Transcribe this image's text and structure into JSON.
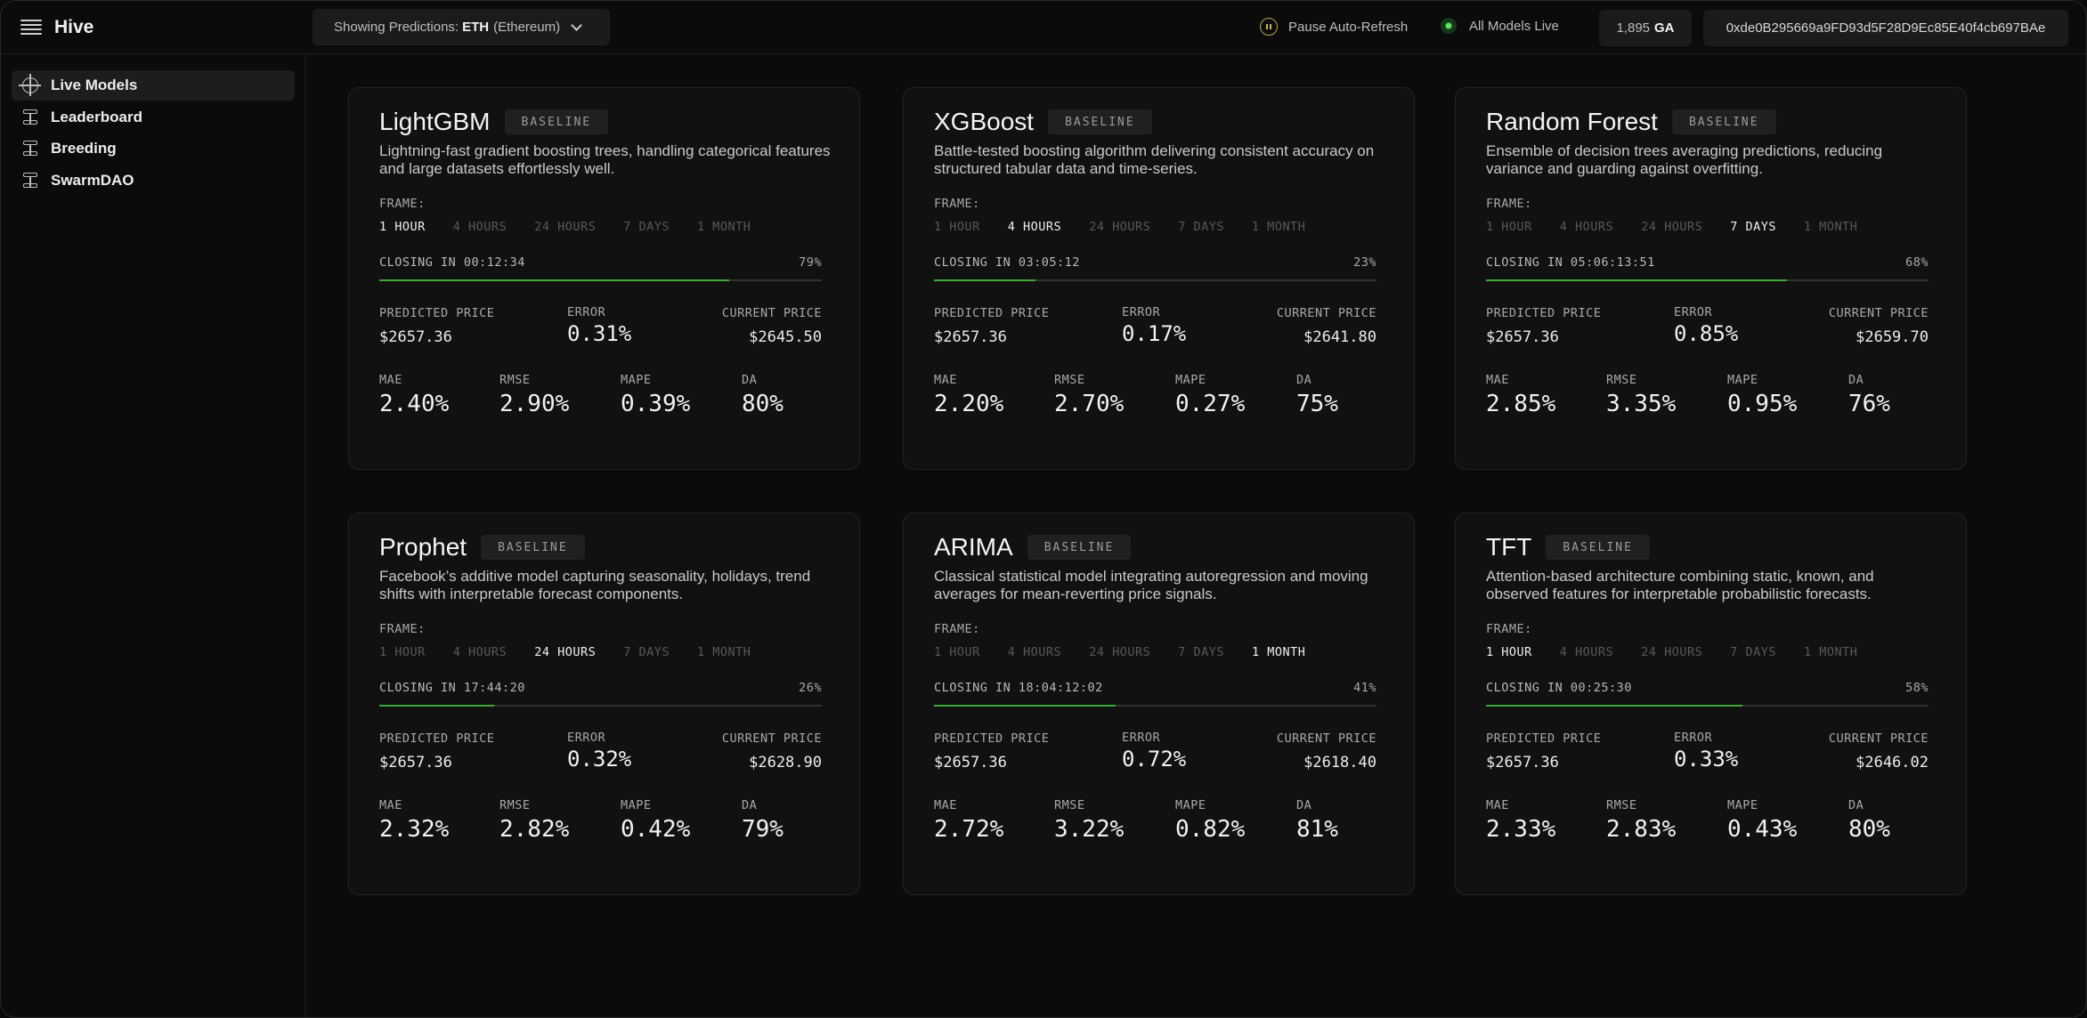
{
  "app": {
    "name": "Hive"
  },
  "header": {
    "selector_prefix": "Showing Predictions:",
    "selector_asset": "ETH",
    "selector_asset_name": "(Ethereum)",
    "pause_label": "Pause Auto-Refresh",
    "live_label": "All Models Live",
    "ga_value": "1,895",
    "ga_unit": "GA",
    "wallet_address": "0xde0B295669a9FD93d5F28D9Ec85E40f4cb697BAe"
  },
  "sidebar": {
    "items": [
      {
        "label": "Live Models",
        "active": true,
        "icon": "crosshair-icon"
      },
      {
        "label": "Leaderboard",
        "active": false,
        "icon": "stack-icon"
      },
      {
        "label": "Breeding",
        "active": false,
        "icon": "stack-icon"
      },
      {
        "label": "SwarmDAO",
        "active": false,
        "icon": "stack-icon"
      }
    ]
  },
  "labels": {
    "frame": "FRAME:",
    "frames": [
      "1 HOUR",
      "4 HOURS",
      "24 HOURS",
      "7 DAYS",
      "1 MONTH"
    ],
    "predicted_price": "PREDICTED PRICE",
    "error": "ERROR",
    "current_price": "CURRENT PRICE",
    "mae": "MAE",
    "rmse": "RMSE",
    "mape": "MAPE",
    "da": "DA"
  },
  "colors": {
    "accent": "#3aa935",
    "live": "#5be35b",
    "pause": "#c9b84e"
  },
  "models": [
    {
      "name": "LightGBM",
      "badge": "BASELINE",
      "description": "Lightning-fast gradient boosting trees, handling categorical features and large datasets effortlessly well.",
      "selected_frame": 0,
      "closing": "CLOSING IN 00:12:34",
      "progress_label": "79%",
      "progress": 0.79,
      "predicted_price": "$2657.36",
      "error": "0.31%",
      "current_price": "$2645.50",
      "mae": "2.40%",
      "rmse": "2.90%",
      "mape": "0.39%",
      "da": "80%"
    },
    {
      "name": "XGBoost",
      "badge": "BASELINE",
      "description": "Battle-tested boosting algorithm delivering consistent accuracy on structured tabular data and time-series.",
      "selected_frame": 1,
      "closing": "CLOSING IN 03:05:12",
      "progress_label": "23%",
      "progress": 0.23,
      "predicted_price": "$2657.36",
      "error": "0.17%",
      "current_price": "$2641.80",
      "mae": "2.20%",
      "rmse": "2.70%",
      "mape": "0.27%",
      "da": "75%"
    },
    {
      "name": "Random Forest",
      "badge": "BASELINE",
      "description": "Ensemble of decision trees averaging predictions, reducing variance and guarding against overfitting.",
      "selected_frame": 3,
      "closing": "CLOSING IN 05:06:13:51",
      "progress_label": "68%",
      "progress": 0.68,
      "predicted_price": "$2657.36",
      "error": "0.85%",
      "current_price": "$2659.70",
      "mae": "2.85%",
      "rmse": "3.35%",
      "mape": "0.95%",
      "da": "76%"
    },
    {
      "name": "Prophet",
      "badge": "BASELINE",
      "description": "Facebook’s additive model capturing seasonality, holidays, trend shifts with interpretable forecast components.",
      "selected_frame": 2,
      "closing": "CLOSING IN 17:44:20",
      "progress_label": "26%",
      "progress": 0.26,
      "predicted_price": "$2657.36",
      "error": "0.32%",
      "current_price": "$2628.90",
      "mae": "2.32%",
      "rmse": "2.82%",
      "mape": "0.42%",
      "da": "79%"
    },
    {
      "name": "ARIMA",
      "badge": "BASELINE",
      "description": "Classical statistical model integrating autoregression and moving averages for mean-reverting price signals.",
      "selected_frame": 4,
      "closing": "CLOSING IN 18:04:12:02",
      "progress_label": "41%",
      "progress": 0.41,
      "predicted_price": "$2657.36",
      "error": "0.72%",
      "current_price": "$2618.40",
      "mae": "2.72%",
      "rmse": "3.22%",
      "mape": "0.82%",
      "da": "81%"
    },
    {
      "name": "TFT",
      "badge": "BASELINE",
      "description": "Attention-based architecture combining static, known, and observed features for interpretable probabilistic forecasts.",
      "selected_frame": 0,
      "closing": "CLOSING IN 00:25:30",
      "progress_label": "58%",
      "progress": 0.58,
      "predicted_price": "$2657.36",
      "error": "0.33%",
      "current_price": "$2646.02",
      "mae": "2.33%",
      "rmse": "2.83%",
      "mape": "0.43%",
      "da": "80%"
    }
  ]
}
